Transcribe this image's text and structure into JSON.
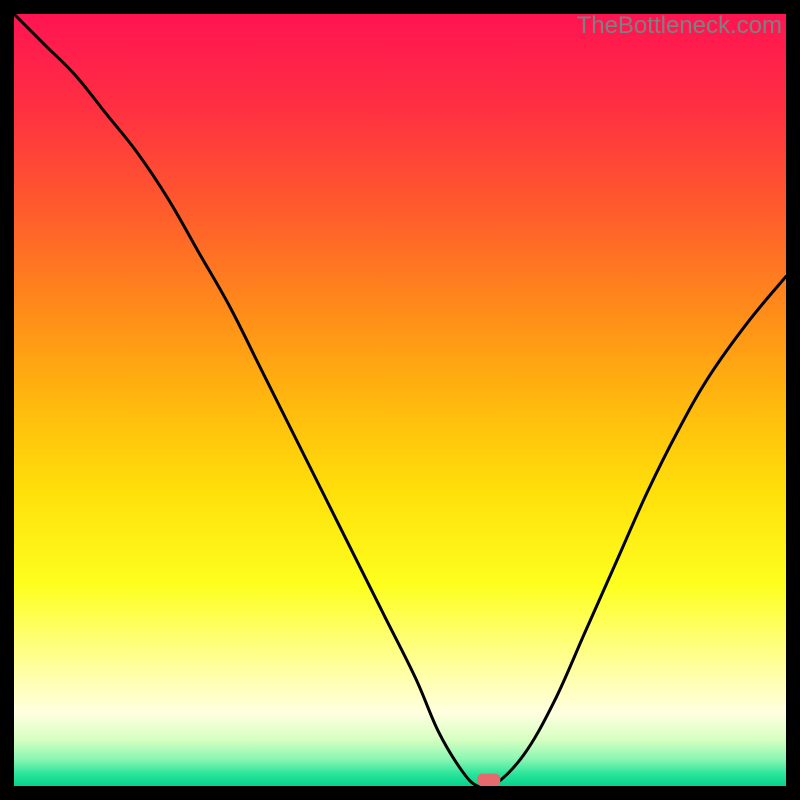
{
  "watermark": "TheBottleneck.com",
  "chart_data": {
    "type": "line",
    "title": "",
    "xlabel": "",
    "ylabel": "",
    "xlim": [
      0,
      100
    ],
    "ylim": [
      0,
      100
    ],
    "background": {
      "type": "vertical-gradient",
      "stops": [
        {
          "pos": 0.0,
          "color": "#ff1452"
        },
        {
          "pos": 0.12,
          "color": "#ff2f42"
        },
        {
          "pos": 0.25,
          "color": "#ff5a2d"
        },
        {
          "pos": 0.38,
          "color": "#ff8a1a"
        },
        {
          "pos": 0.5,
          "color": "#ffb70e"
        },
        {
          "pos": 0.62,
          "color": "#ffe00a"
        },
        {
          "pos": 0.74,
          "color": "#fdff1f"
        },
        {
          "pos": 0.85,
          "color": "#ffffa2"
        },
        {
          "pos": 0.905,
          "color": "#ffffe0"
        },
        {
          "pos": 0.94,
          "color": "#d7ffc2"
        },
        {
          "pos": 0.965,
          "color": "#8bf6b3"
        },
        {
          "pos": 0.985,
          "color": "#28e49a"
        },
        {
          "pos": 1.0,
          "color": "#05d38a"
        }
      ]
    },
    "series": [
      {
        "name": "bottleneck-curve",
        "color": "#000000",
        "x": [
          0,
          4,
          8,
          12,
          16,
          20,
          24,
          28,
          32,
          36,
          40,
          44,
          48,
          52,
          55,
          58,
          60,
          62,
          66,
          70,
          74,
          78,
          82,
          86,
          90,
          95,
          100
        ],
        "y": [
          100,
          96,
          92,
          87,
          82,
          76,
          69,
          62,
          54,
          46,
          38,
          30,
          22,
          14,
          7,
          2,
          0,
          0,
          4,
          11,
          20,
          29,
          38,
          46,
          53,
          60,
          66
        ]
      }
    ],
    "markers": [
      {
        "name": "optimum-marker",
        "shape": "rounded-rect",
        "x": 61.5,
        "y": 0.8,
        "width_pct": 3.0,
        "height_pct": 1.6,
        "fill": "#e46a6d"
      }
    ]
  }
}
